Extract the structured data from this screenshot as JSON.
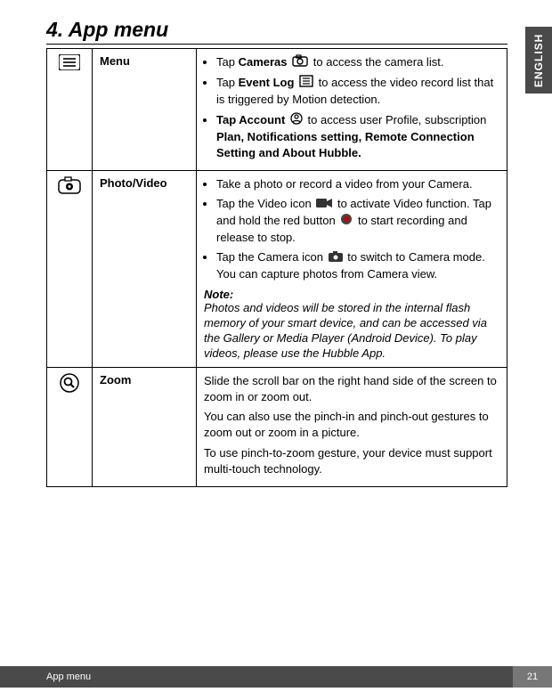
{
  "side_tab": "ENGLISH",
  "heading": "4. App menu",
  "rows": {
    "menu": {
      "label": "Menu",
      "item1": {
        "pre": "Tap ",
        "bold": "Cameras",
        "post": " to access the camera list."
      },
      "item2": {
        "pre": "Tap ",
        "bold": "Event Log",
        "post": " to access the video record list that is triggered by Motion detection."
      },
      "item3": {
        "bold": "Tap Account",
        "mid": " to access user Profile, subscription ",
        "bold2": "Plan, Notifications setting, Remote Connection Setting and About Hubble."
      }
    },
    "photo": {
      "label": "Photo/Video",
      "item1": "Take a photo or record a video from your Camera.",
      "item2": {
        "a": "Tap the Video icon ",
        "b": " to activate Video function. Tap and hold the red button ",
        "c": " to start recording and release to stop."
      },
      "item3": {
        "a": "Tap the Camera icon ",
        "b": " to switch to Camera mode. You can capture photos from Camera view."
      },
      "note_label": "Note:",
      "note_body": "Photos and videos will be stored in the internal flash memory of your smart device, and can be accessed via the Gallery or Media Player (Android Device). To play videos, please use the Hubble App."
    },
    "zoom": {
      "label": "Zoom",
      "p1": "Slide the scroll bar on the right hand side of the screen to zoom in or zoom out.",
      "p2": "You can also use the pinch-in and pinch-out gestures to zoom out or zoom in a picture.",
      "p3": "To use pinch-to-zoom gesture, your device must support multi-touch technology."
    }
  },
  "footer": {
    "label": "App menu",
    "page_num": "21"
  }
}
